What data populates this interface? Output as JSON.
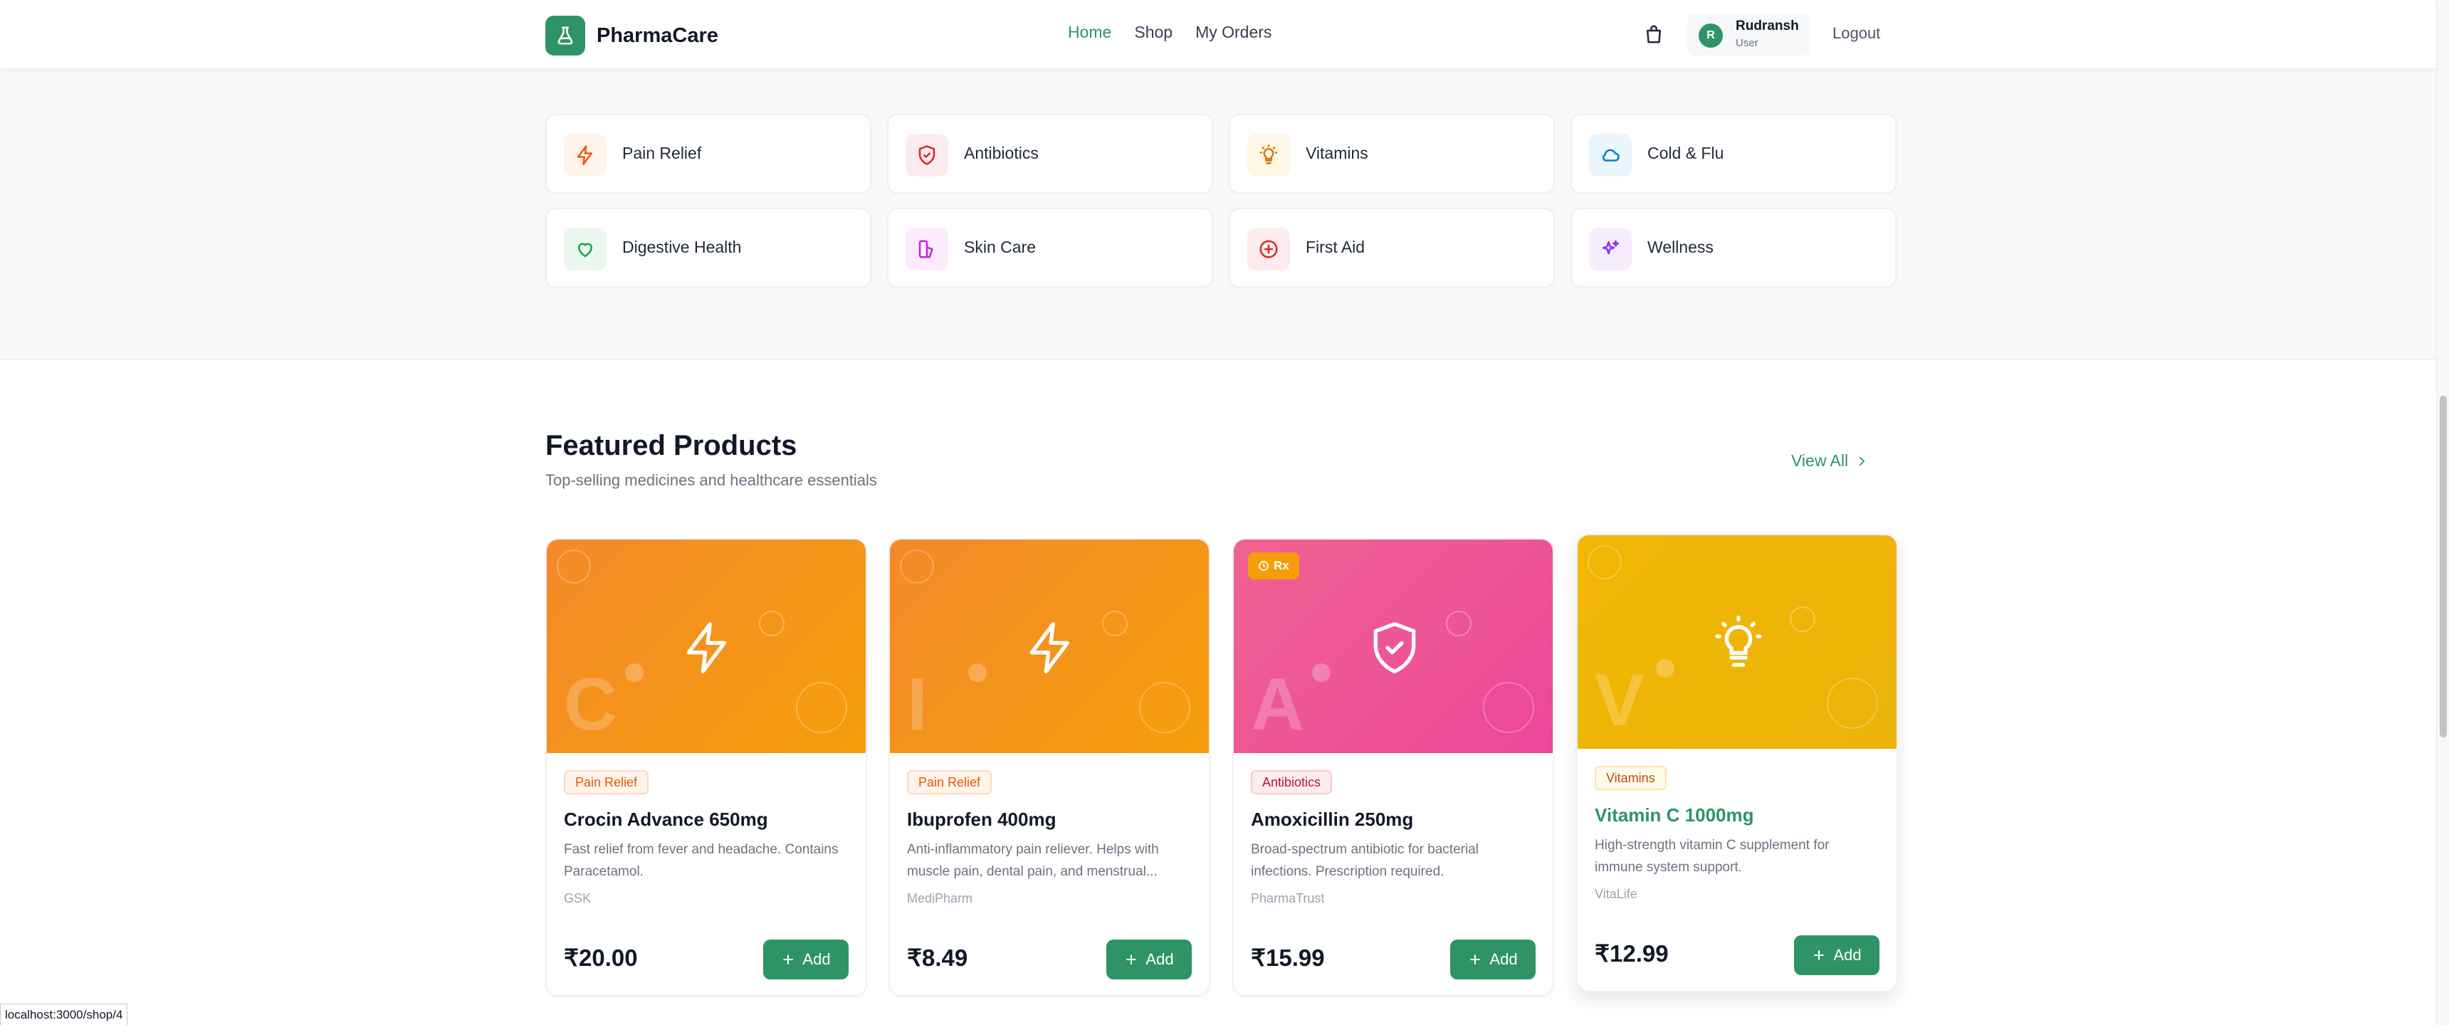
{
  "header": {
    "brand": "PharmaCare",
    "nav": [
      "Home",
      "Shop",
      "My Orders"
    ],
    "active_nav": "Home",
    "user": {
      "initial": "R",
      "name": "Rudransh",
      "role": "User"
    },
    "logout_label": "Logout",
    "icons": {
      "logo": "flask-icon",
      "cart": "shopping-bag-icon"
    }
  },
  "categories": [
    {
      "label": "Pain Relief",
      "icon": "lightning-icon",
      "color": "#ea580c",
      "bg": "#fff3ea"
    },
    {
      "label": "Antibiotics",
      "icon": "shield-icon",
      "color": "#dc2626",
      "bg": "#fdecee"
    },
    {
      "label": "Vitamins",
      "icon": "lightbulb-icon",
      "color": "#d97706",
      "bg": "#fff7e6"
    },
    {
      "label": "Cold & Flu",
      "icon": "cloud-icon",
      "color": "#0284c7",
      "bg": "#eaf5fd"
    },
    {
      "label": "Digestive Health",
      "icon": "heart-icon",
      "color": "#16a34a",
      "bg": "#ebf8f0"
    },
    {
      "label": "Skin Care",
      "icon": "skin-care-icon",
      "color": "#c026d3",
      "bg": "#fcebfd"
    },
    {
      "label": "First Aid",
      "icon": "plus-circle-icon",
      "color": "#dc2626",
      "bg": "#fdecee"
    },
    {
      "label": "Wellness",
      "icon": "sparkles-icon",
      "color": "#9333ea",
      "bg": "#f5ecfd"
    }
  ],
  "featured": {
    "title": "Featured Products",
    "subtitle": "Top-selling medicines and healthcare essentials",
    "view_all_label": "View All"
  },
  "products": [
    {
      "name": "Crocin Advance 650mg",
      "category": "Pain Relief",
      "description": "Fast relief from fever and headache. Contains Paracetamol.",
      "brand": "GSK",
      "price": "₹20.00",
      "letter": "C",
      "rx": "",
      "add_label": "Add",
      "icon": "lightning-icon",
      "gradient": [
        "#f4892a",
        "#f59e0b"
      ]
    },
    {
      "name": "Ibuprofen 400mg",
      "category": "Pain Relief",
      "description": "Anti-inflammatory pain reliever. Helps with muscle pain, dental pain, and menstrual...",
      "brand": "MediPharm",
      "price": "₹8.49",
      "letter": "I",
      "rx": "",
      "add_label": "Add",
      "icon": "lightning-icon",
      "gradient": [
        "#f4892a",
        "#f59e0b"
      ]
    },
    {
      "name": "Amoxicillin 250mg",
      "category": "Antibiotics",
      "description": "Broad-spectrum antibiotic for bacterial infections. Prescription required.",
      "brand": "PharmaTrust",
      "price": "₹15.99",
      "letter": "A",
      "rx": "Rx",
      "add_label": "Add",
      "icon": "shield-check-icon",
      "gradient": [
        "#f06292",
        "#ec4899"
      ]
    },
    {
      "name": "Vitamin C 1000mg",
      "category": "Vitamins",
      "description": "High-strength vitamin C supplement for immune system support.",
      "brand": "VitaLife",
      "price": "₹12.99",
      "letter": "V",
      "rx": "",
      "add_label": "Add",
      "icon": "lightbulb-icon",
      "gradient": [
        "#f2b705",
        "#eab308"
      ]
    }
  ],
  "status_bar_url": "localhost:3000/shop/4"
}
